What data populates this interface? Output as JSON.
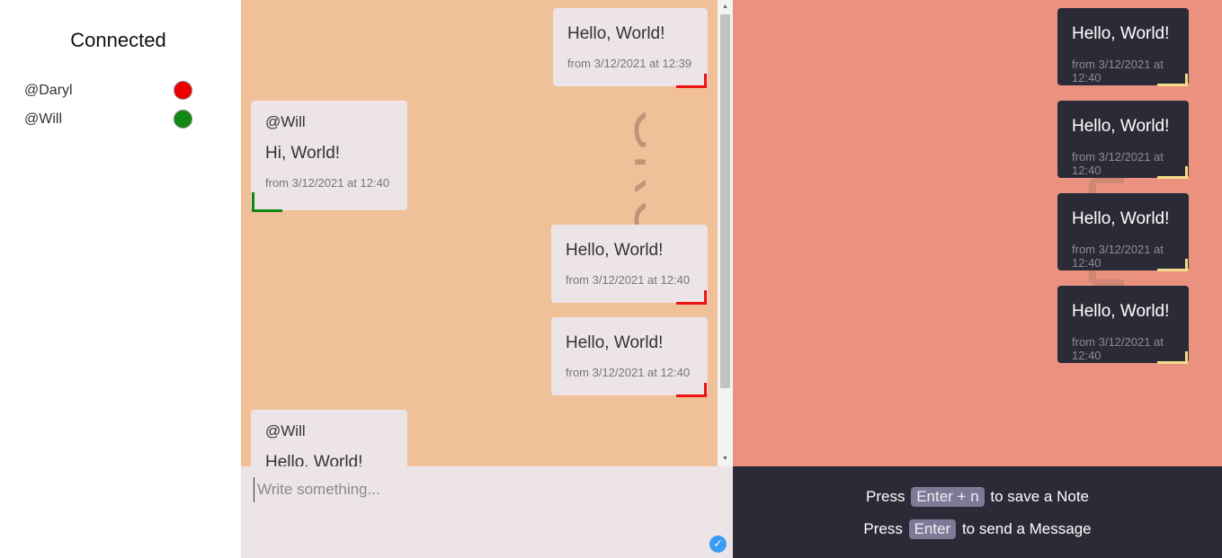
{
  "sidebar": {
    "title": "Connected",
    "users": [
      {
        "name": "@Daryl",
        "status_color": "#ee0000"
      },
      {
        "name": "@Will",
        "status_color": "#118811"
      }
    ]
  },
  "group": {
    "watermark": "GROUP",
    "messages": [
      {
        "side": "right",
        "text": "Hello, World!",
        "time": "from 3/12/2021 at 12:39"
      },
      {
        "side": "left",
        "author": "@Will",
        "text": "Hi, World!",
        "time": "from 3/12/2021 at 12:40"
      },
      {
        "side": "right",
        "text": "Hello, World!",
        "time": "from 3/12/2021 at 12:40"
      },
      {
        "side": "right",
        "text": "Hello, World!",
        "time": "from 3/12/2021 at 12:40"
      },
      {
        "side": "left",
        "author": "@Will",
        "text": "Hello, World!"
      }
    ]
  },
  "notes": {
    "items": [
      {
        "text": "Hello, World!",
        "time": "from 3/12/2021 at 12:40"
      },
      {
        "text": "Hello, World!",
        "time": "from 3/12/2021 at 12:40"
      },
      {
        "text": "Hello, World!",
        "time": "from 3/12/2021 at 12:40"
      },
      {
        "text": "Hello, World!",
        "time": "from 3/12/2021 at 12:40"
      }
    ]
  },
  "composer": {
    "placeholder": "Write something..."
  },
  "help": {
    "note_prefix": "Press",
    "note_key": "Enter + n",
    "note_suffix": "to save a Note",
    "send_prefix": "Press",
    "send_key": "Enter",
    "send_suffix": "to send a Message"
  },
  "colors": {
    "group_bg": "#f0c098",
    "notes_bg": "#eb9180",
    "bubble_bg": "#ede4e8",
    "note_bg": "#2b2b37",
    "own_corner": "#ee1111",
    "other_corner": "#118811",
    "note_corner": "#f4dc8a"
  }
}
